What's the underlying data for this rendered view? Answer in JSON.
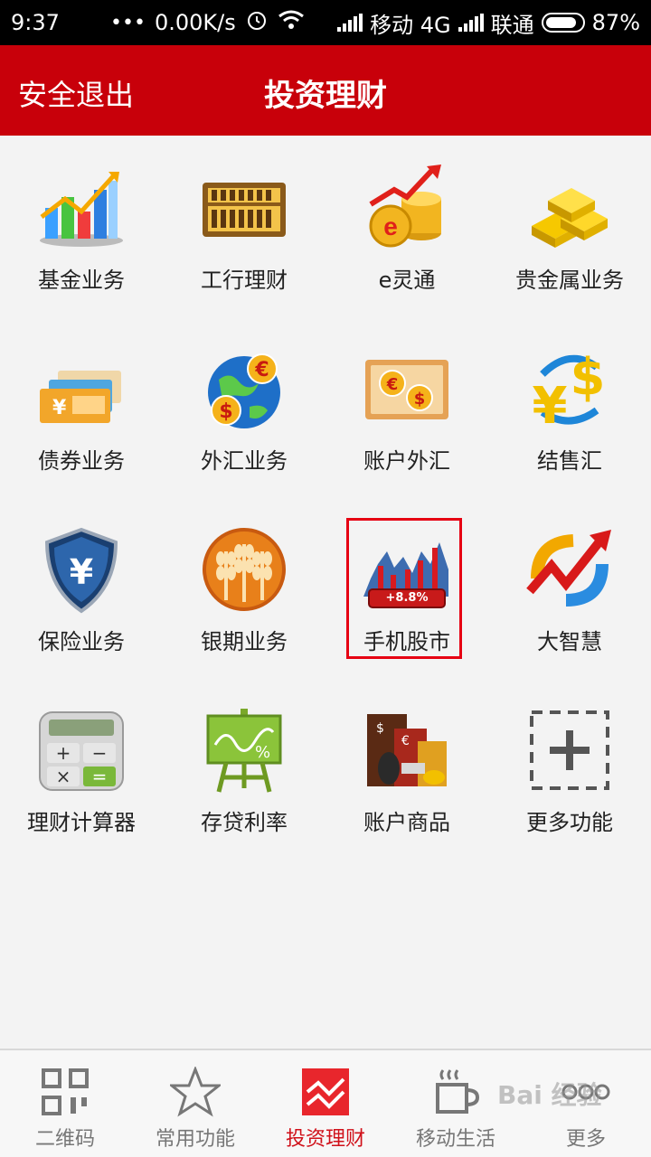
{
  "status_bar": {
    "time": "9:37",
    "speed": "0.00K/s",
    "carrier1": "移动 4G",
    "carrier2": "联通",
    "battery": "87%",
    "battery_level": 0.87
  },
  "header": {
    "logout_label": "安全退出",
    "title": "投资理财",
    "bg_color": "#c8000a"
  },
  "grid": {
    "items": [
      {
        "label": "基金业务",
        "icon": "fund-chart-icon"
      },
      {
        "label": "工行理财",
        "icon": "abacus-icon"
      },
      {
        "label": "e灵通",
        "icon": "e-coins-icon"
      },
      {
        "label": "贵金属业务",
        "icon": "gold-bars-icon"
      },
      {
        "label": "债券业务",
        "icon": "bonds-icon"
      },
      {
        "label": "外汇业务",
        "icon": "globe-currency-icon"
      },
      {
        "label": "账户外汇",
        "icon": "currency-card-icon"
      },
      {
        "label": "结售汇",
        "icon": "yen-dollar-exchange-icon"
      },
      {
        "label": "保险业务",
        "icon": "yen-shield-icon"
      },
      {
        "label": "银期业务",
        "icon": "wheat-icon"
      },
      {
        "label": "手机股市",
        "icon": "stock-chart-icon",
        "badge": "+8.8%"
      },
      {
        "label": "大智慧",
        "icon": "trend-arrow-icon"
      },
      {
        "label": "理财计算器",
        "icon": "calculator-icon"
      },
      {
        "label": "存贷利率",
        "icon": "rate-board-icon"
      },
      {
        "label": "账户商品",
        "icon": "commodity-icon"
      },
      {
        "label": "更多功能",
        "icon": "add-more-icon"
      }
    ],
    "highlighted_item": "手机股市"
  },
  "bottom_nav": {
    "items": [
      {
        "label": "二维码",
        "icon": "qrcode-icon"
      },
      {
        "label": "常用功能",
        "icon": "star-icon"
      },
      {
        "label": "投资理财",
        "icon": "invest-chart-icon",
        "active": true
      },
      {
        "label": "移动生活",
        "icon": "coffee-cup-icon"
      },
      {
        "label": "更多",
        "icon": "more-dots-icon"
      }
    ],
    "active_color": "#d0111a"
  },
  "watermark": "Bai 经验"
}
